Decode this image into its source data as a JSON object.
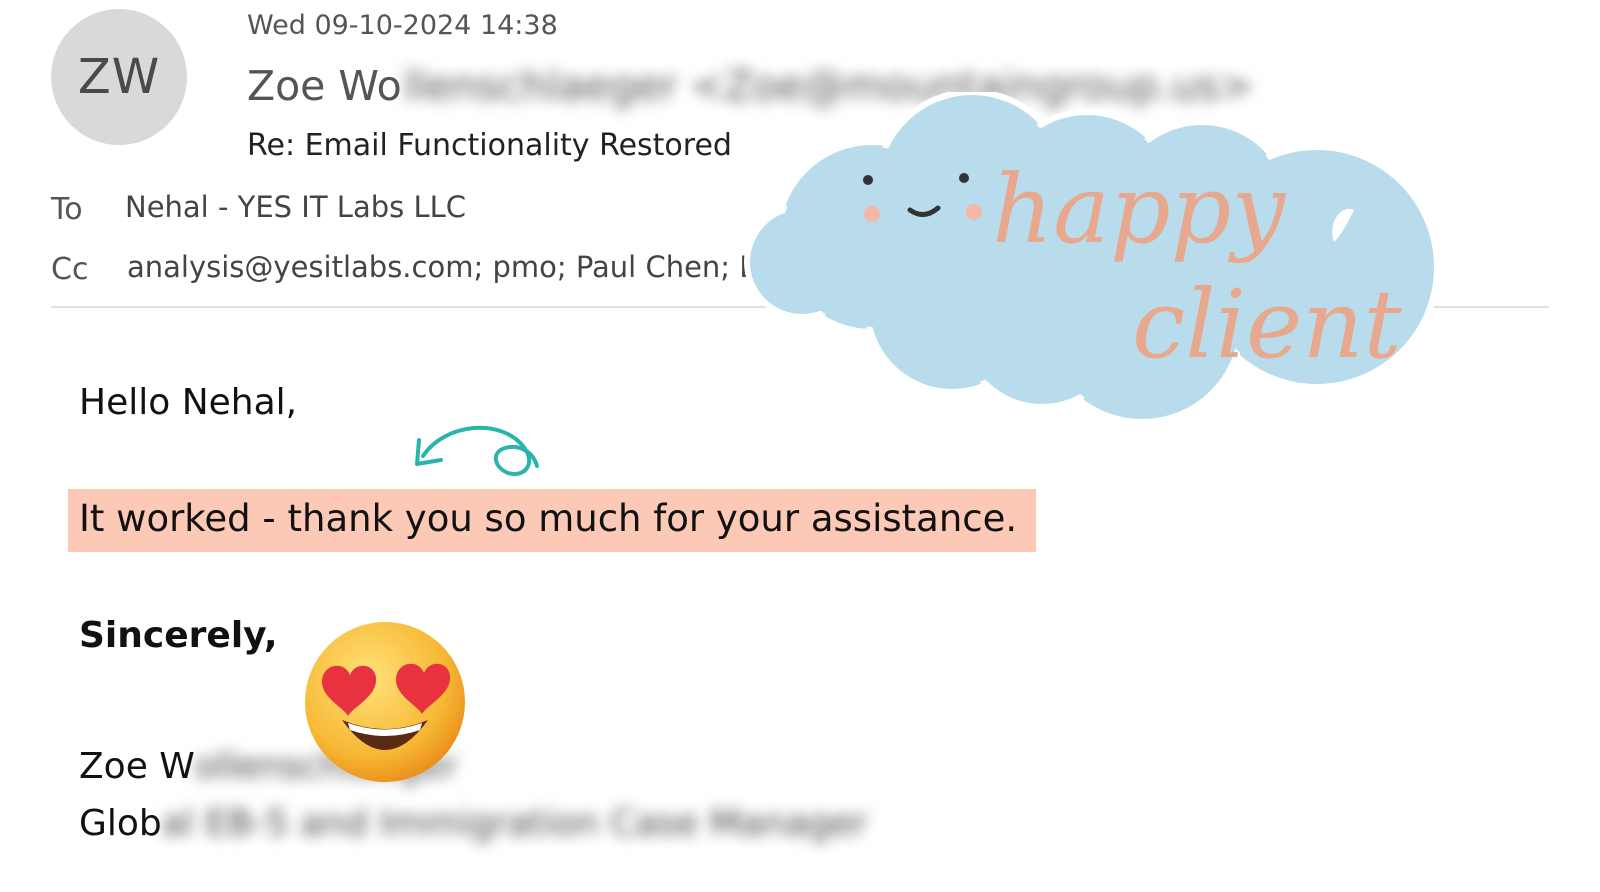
{
  "email": {
    "avatar_initials": "ZW",
    "date": "Wed 09-10-2024 14:38",
    "from_name": "Zoe Wo",
    "from_blurred": "llenschlaeger <Zoe@mountaingroup.us>",
    "subject": "Re: Email Functionality Restored",
    "to_label": "To",
    "to_value": "Nehal - YES IT Labs LLC",
    "cc_label": "Cc",
    "cc_value": "analysis@yesitlabs.com; pmo; Paul Chen; E"
  },
  "body": {
    "greeting": "Hello Nehal,",
    "highlight": "It worked - thank you so much for your assistance.",
    "signoff": "Sincerely,",
    "sig_name": "Zoe W",
    "sig_name_blurred": "ollenschlaeger",
    "sig_title": "Glob",
    "sig_title_blurred": "al EB-5 and Immigration Case Manager"
  },
  "sticker": {
    "line1": "happy",
    "line2": "client"
  },
  "colors": {
    "highlight": "#fcc9b7",
    "cloud": "#b9dcec",
    "sticker_text": "#e8a88e",
    "arrow": "#2bb3ad"
  },
  "icons": {
    "avatar": "avatar-initials",
    "arrow": "curly-arrow-icon",
    "emoji": "heart-eyes-emoji-icon",
    "sticker": "cloud-sticker-icon"
  }
}
